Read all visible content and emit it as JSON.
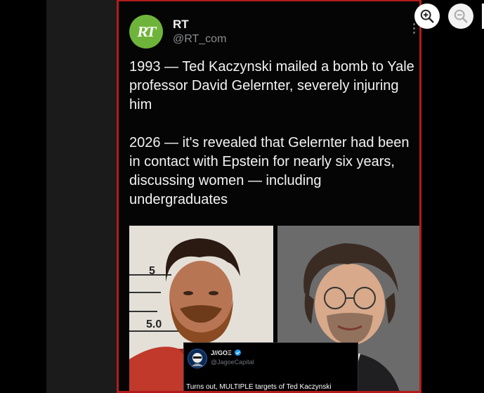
{
  "tweet": {
    "avatar_label": "RT",
    "display_name": "RT",
    "handle": "@RT_com",
    "paragraphs": [
      "1993 — Ted Kaczynski mailed a bomb to Yale professor David Gelernter, severely injuring him",
      "2026 — it's revealed that Gelernter had been in contact with Epstein for nearly six years, discussing women — including undergraduates"
    ],
    "photo_marks": [
      "5",
      "5.0"
    ]
  },
  "quote_tweet": {
    "name": "J//GOΞ",
    "handle": "@JagoeCapital",
    "text": "Turns out, MULTIPLE targets of Ted Kaczynski"
  },
  "viewer_toolbar": {
    "zoom_in_icon": "zoom-in-icon",
    "zoom_out_icon": "zoom-out-icon"
  },
  "colors": {
    "frame_border": "#b31c1c",
    "rt_green": "#6fb43a",
    "verified_blue": "#1d9bf0"
  }
}
